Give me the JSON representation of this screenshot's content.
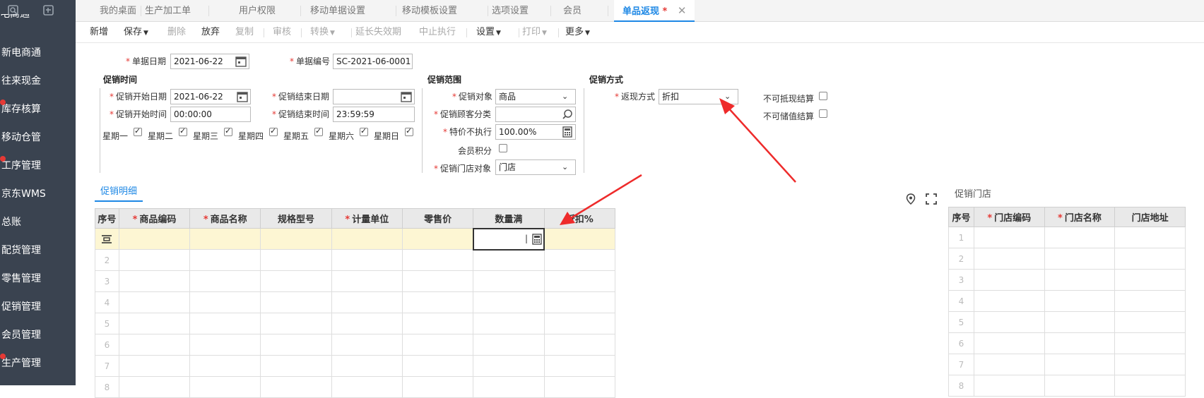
{
  "sidebar": {
    "top_icons": [
      "search-doc-icon",
      "new-doc-icon"
    ],
    "partial_top_label": "电商通",
    "items": [
      {
        "label": "新电商通",
        "badge": false
      },
      {
        "label": "往来现金",
        "badge": false
      },
      {
        "label": "库存核算",
        "badge": true
      },
      {
        "label": "移动仓管",
        "badge": false
      },
      {
        "label": "工序管理",
        "badge": true
      },
      {
        "label": "京东WMS",
        "badge": false
      },
      {
        "label": "总账",
        "badge": false
      },
      {
        "label": "配货管理",
        "badge": false
      },
      {
        "label": "零售管理",
        "badge": false
      },
      {
        "label": "促销管理",
        "badge": false
      },
      {
        "label": "会员管理",
        "badge": false
      },
      {
        "label": "生产管理",
        "badge": true
      }
    ]
  },
  "tabs": [
    "我的桌面",
    "生产加工单",
    "用户权限",
    "移动单据设置",
    "移动模板设置",
    "选项设置",
    "会员"
  ],
  "active_tab": {
    "label": "单品返现",
    "modified_mark": "*",
    "close": "✕"
  },
  "toolbar": {
    "new": "新增",
    "save": "保存",
    "delete": "删除",
    "abandon": "放弃",
    "copy": "复制",
    "audit": "审核",
    "convert": "转换",
    "extend": "延长失效期",
    "stop": "中止执行",
    "settings": "设置",
    "print": "打印",
    "more": "更多"
  },
  "header": {
    "doc_date_label": "单据日期",
    "doc_date": "2021-06-22",
    "doc_no_label": "单据编号",
    "doc_no": "SC-2021-06-0001"
  },
  "promo_time": {
    "title": "促销时间",
    "start_date_label": "促销开始日期",
    "start_date": "2021-06-22",
    "end_date_label": "促销结束日期",
    "end_date": "",
    "start_time_label": "促销开始时间",
    "start_time": "00:00:00",
    "end_time_label": "促销结束时间",
    "end_time": "23:59:59",
    "weekdays": [
      "星期一",
      "星期二",
      "星期三",
      "星期四",
      "星期五",
      "星期六",
      "星期日"
    ]
  },
  "promo_scope": {
    "title": "促销范围",
    "target_label": "促销对象",
    "target": "商品",
    "customer_class_label": "促销顾客分类",
    "customer_class": "",
    "special_label": "特价不执行",
    "special": "100.00%",
    "points_label": "会员积分",
    "store_target_label": "促销门店对象",
    "store_target": "门店"
  },
  "promo_method": {
    "title": "促销方式",
    "cashback_label": "返现方式",
    "cashback": "折扣",
    "no_offset_label": "不可抵现结算",
    "no_stored_label": "不可储值结算"
  },
  "detail": {
    "tab_label": "促销明细",
    "columns": [
      "序号",
      "商品编码",
      "商品名称",
      "规格型号",
      "计量单位",
      "零售价",
      "数量满",
      "折扣%"
    ],
    "required": [
      false,
      true,
      true,
      false,
      true,
      false,
      false,
      false
    ],
    "rows": [
      "",
      "2",
      "3",
      "4",
      "5",
      "6",
      "7",
      "8"
    ]
  },
  "stores": {
    "title": "促销门店",
    "columns": [
      "序号",
      "门店编码",
      "门店名称",
      "门店地址"
    ],
    "required": [
      false,
      true,
      true,
      false
    ],
    "rows": [
      "1",
      "2",
      "3",
      "4",
      "5",
      "6",
      "7",
      "8"
    ]
  },
  "colors": {
    "accent": "#1e88e5",
    "sidebar": "#3a4350",
    "required": "#e53935",
    "annotation_arrow": "#ee2b2b",
    "selected_row": "#fdf6d3"
  }
}
